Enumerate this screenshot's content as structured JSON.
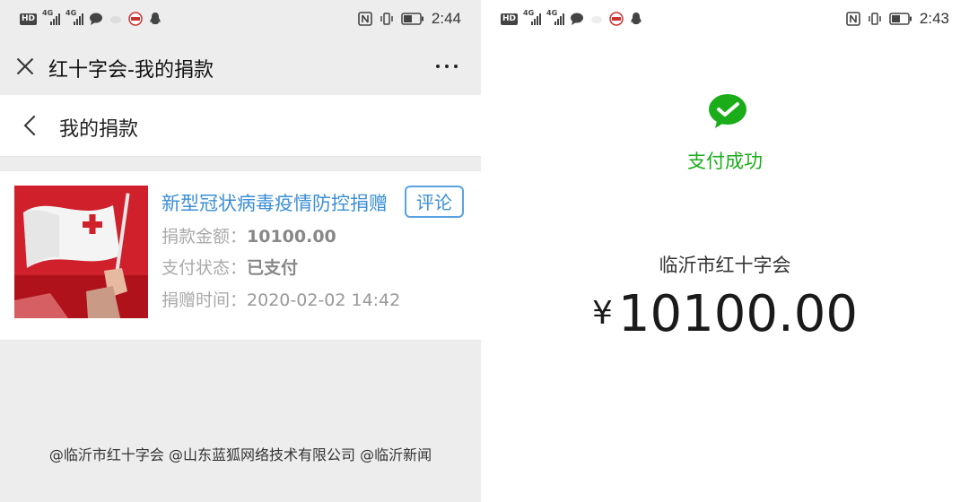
{
  "left": {
    "status": {
      "time": "2:44",
      "hd": "HD",
      "net": "4G"
    },
    "titlebar": {
      "title": "红十字会-我的捐款"
    },
    "header": {
      "title": "我的捐款"
    },
    "donation": {
      "project_name": "新型冠状病毒疫情防控捐赠",
      "comment_label": "评论",
      "amount_label": "捐款金额：",
      "amount_value": "10100.00",
      "pay_status_label": "支付状态：",
      "pay_status_value": "已支付",
      "time_label": "捐赠时间：",
      "time_value": "2020-02-02 14:42"
    },
    "footer": "@临沂市红十字会 @山东蓝狐网络技术有限公司 @临沂新闻"
  },
  "right": {
    "status": {
      "time": "2:43",
      "hd": "HD",
      "net": "4G"
    },
    "payment": {
      "status_text": "支付成功",
      "payee": "临沂市红十字会",
      "currency": "¥",
      "amount": "10100.00"
    }
  },
  "colors": {
    "wechat_green": "#1aad19",
    "link_blue": "#3b8fd6",
    "red_cross": "#d9272e"
  },
  "icons": [
    "close-icon",
    "more-icon",
    "back-chevron-icon",
    "wechat-pay-icon",
    "nfc-icon",
    "vibrate-icon",
    "battery-icon",
    "signal-icon",
    "chat-icon",
    "qq-icon"
  ]
}
